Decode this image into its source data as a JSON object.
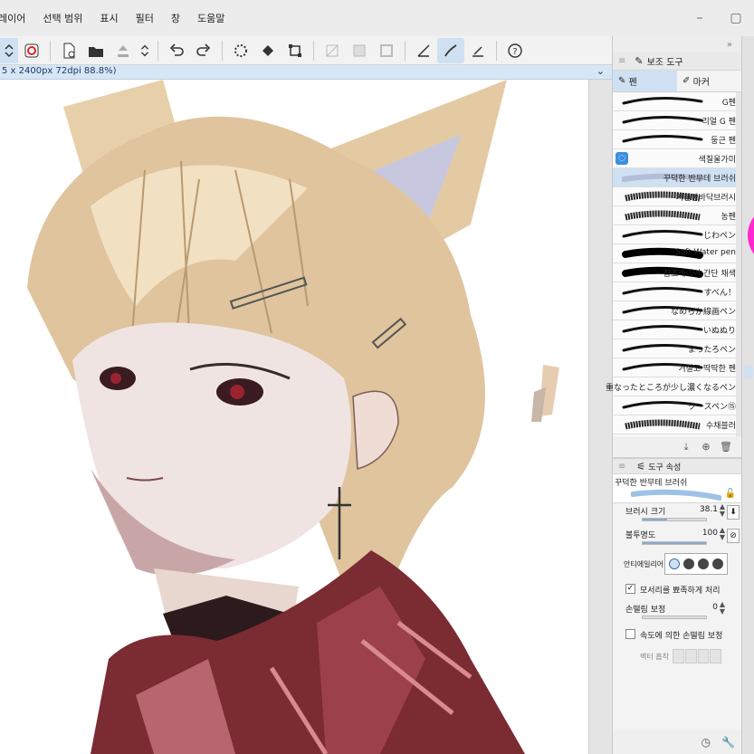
{
  "menu": {
    "items": [
      "레이어",
      "선택 범위",
      "표시",
      "필터",
      "창",
      "도움말"
    ],
    "window_controls": [
      "–",
      "▢"
    ]
  },
  "document": {
    "info": "5 x 2400px 72dpi 88.8%)"
  },
  "toolbar": {
    "icons": [
      "updown-icon",
      "stabilizer-icon",
      "new-file-icon",
      "open-file-icon",
      "save-icon",
      "updown2-icon",
      "undo-icon",
      "redo-icon",
      "loading-icon",
      "fill-icon",
      "transform-icon",
      "clear-icon",
      "fill-gray-icon",
      "frame-icon",
      "ruler-icon",
      "pen-active-icon",
      "snap-icon",
      "help-icon"
    ]
  },
  "sub_tool": {
    "panel_title": "보조 도구",
    "tabs": [
      "펜",
      "마커"
    ],
    "selected_tab": 0,
    "brushes": [
      {
        "name": "G펜",
        "stroke": "taper"
      },
      {
        "name": "리얼 G 펜",
        "stroke": "taper"
      },
      {
        "name": "둥근 펜",
        "stroke": "taper"
      },
      {
        "name": "색칠울가미",
        "stroke": "none",
        "icon": true
      },
      {
        "name": "꾸덕한 반무테 브러쉬",
        "stroke": "soft",
        "selected": true
      },
      {
        "name": "거칠빵바닥브러시",
        "stroke": "rough"
      },
      {
        "name": "농펜",
        "stroke": "rough"
      },
      {
        "name": "じわペン",
        "stroke": "taper"
      },
      {
        "name": "Soft Water pen",
        "stroke": "bold"
      },
      {
        "name": "참조레이어 간단 채색",
        "stroke": "bold"
      },
      {
        "name": "すべん！",
        "stroke": "taper"
      },
      {
        "name": "なめらか線画ペン",
        "stroke": "taper"
      },
      {
        "name": "いぬぬり",
        "stroke": "taper"
      },
      {
        "name": "まったろペン",
        "stroke": "taper"
      },
      {
        "name": "거칠고 딱딱한 펜",
        "stroke": "taper"
      },
      {
        "name": "重なったところが少し濃くなるペン",
        "stroke": "none"
      },
      {
        "name": "クースペン⑮",
        "stroke": "taper"
      },
      {
        "name": "수채블러",
        "stroke": "rough"
      }
    ],
    "footer_icons": [
      "download-icon",
      "add-icon",
      "delete-icon"
    ]
  },
  "tool_property": {
    "title": "도구 속성",
    "brush_name": "꾸덕한 반무테 브러쉬",
    "brush_size_label": "브러시 크기",
    "brush_size_value": "38.1",
    "brush_size_fraction": 0.38,
    "opacity_label": "불투명도",
    "opacity_value": "100",
    "opacity_fraction": 1.0,
    "antialias_label": "안티에일리어",
    "antialias_selected": 0,
    "sharpen_label": "모서리를 뾰족하게 처리",
    "sharpen_checked": true,
    "stabilize_label": "손떨림 보정",
    "stabilize_value": "0",
    "stabilize_fraction": 0.0,
    "speed_label": "속도에 의한 손떨림 보정",
    "speed_checked": false,
    "vector_label": "벡터 흡착"
  },
  "colors": {
    "accent": "#cfe0f3",
    "accent_dark": "#3b6ea8"
  }
}
